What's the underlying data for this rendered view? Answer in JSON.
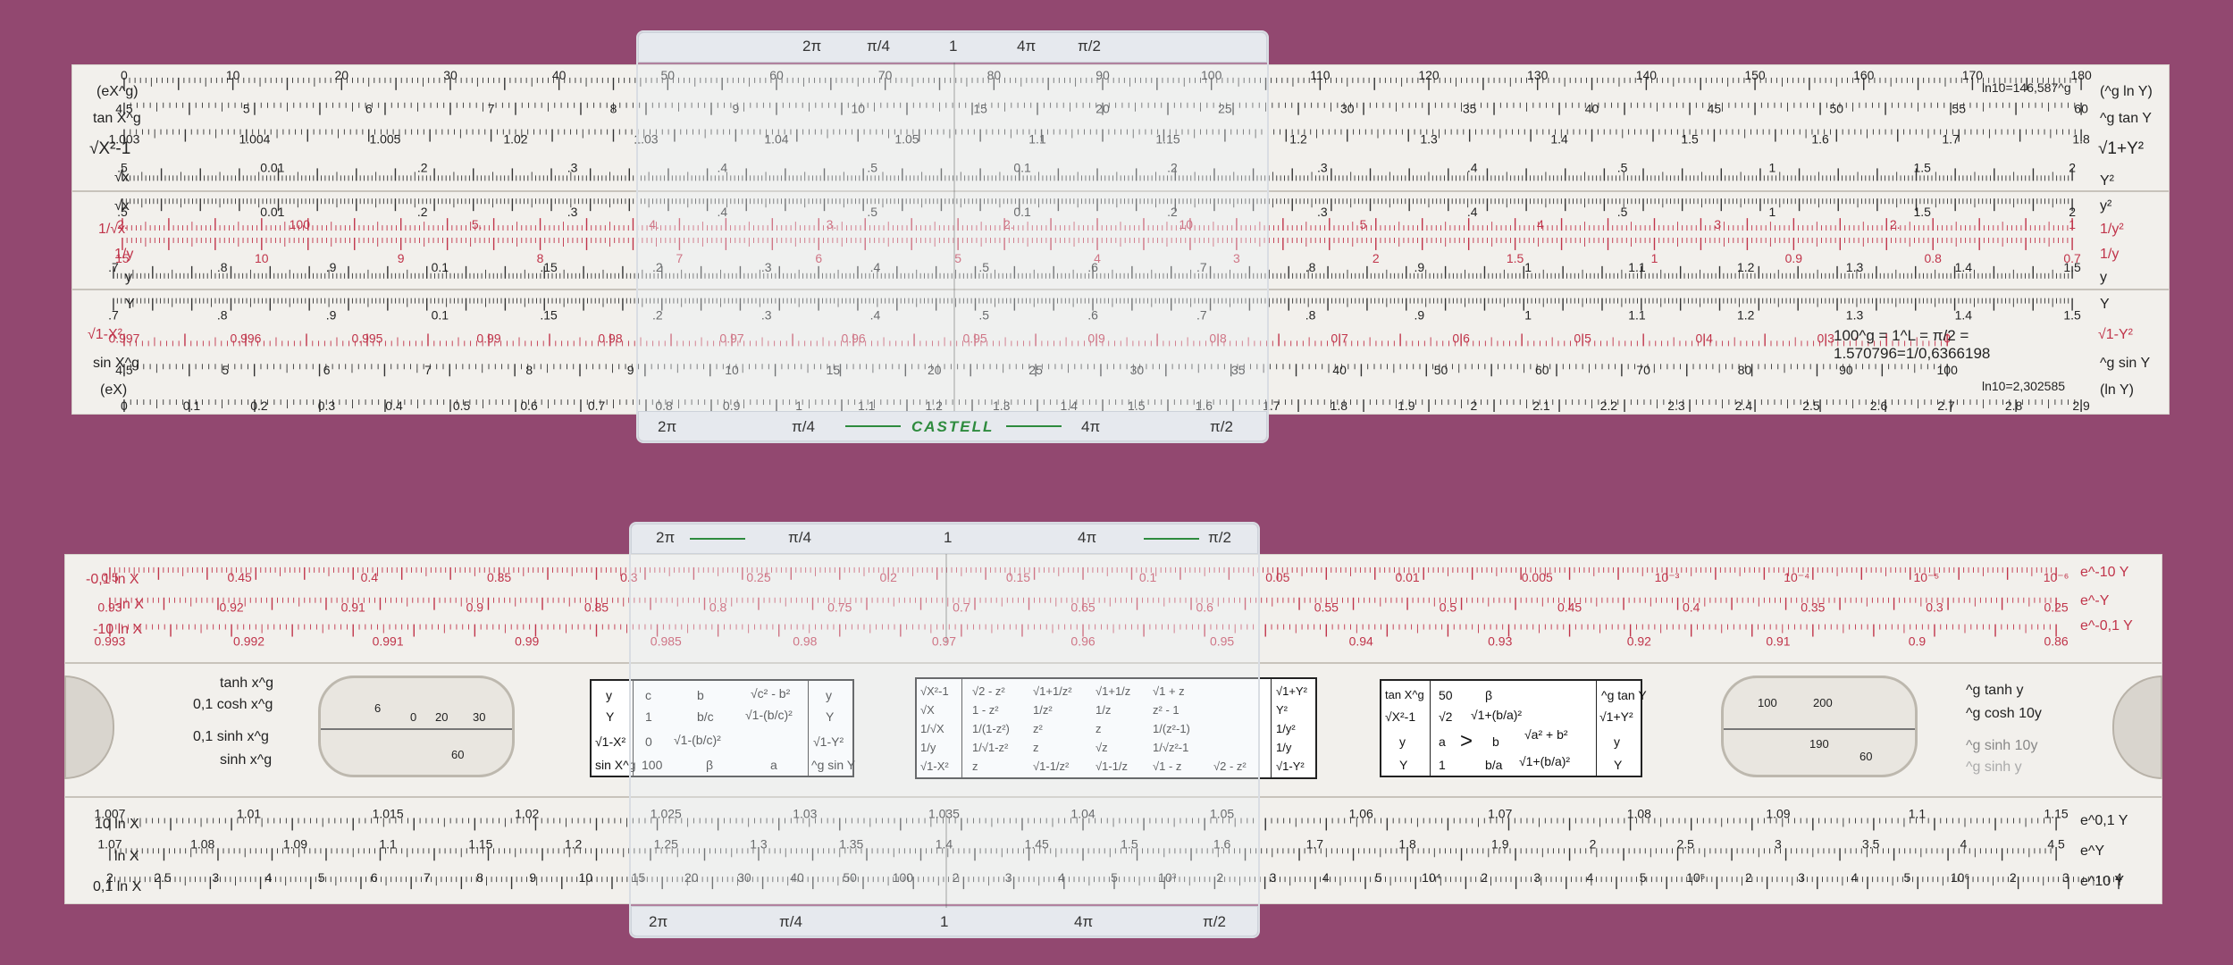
{
  "colors": {
    "background": "#924870",
    "rule": "#f2f0ec",
    "red": "#c0344a",
    "green": "#2e8b3e"
  },
  "top_rule": {
    "cursor": {
      "top": [
        "2π",
        "π/4",
        "1",
        "4π",
        "π/2"
      ],
      "bottom": [
        "2π",
        "π/4",
        "CASTELL",
        "4π",
        "π/2"
      ]
    },
    "left_labels": [
      "(eX^g)",
      "tan X^g",
      "√X²-1",
      "√x",
      "√x",
      "1/√x",
      "1/y",
      "y",
      "Y",
      "√1-X²",
      "sin X^g",
      "(eX)"
    ],
    "right_labels": [
      "(^g ln Y)",
      "^g tan Y",
      "√1+Y²",
      "Y²",
      "y²",
      "1/y²",
      "1/y",
      "y",
      "Y",
      "√1-Y²",
      "^g sin Y",
      "(ln Y)"
    ],
    "notes": [
      "ln10=146,587^g",
      "100^g = 1^L = π/2 =",
      "1.570796=1/0,6366198",
      "ln10=2,302585"
    ],
    "row1": [
      "0",
      "10",
      "20",
      "30",
      "40",
      "50",
      "60",
      "70",
      "80",
      "90",
      "100",
      "110",
      "120",
      "130",
      "140",
      "150",
      "160",
      "170",
      "180"
    ],
    "row2": [
      "4.5",
      "5",
      "6",
      "7",
      "8",
      "9",
      "10",
      "15",
      "20",
      "25",
      "30",
      "35",
      "40",
      "45",
      "50",
      "55",
      "60"
    ],
    "row3": [
      "1.003",
      "1.004",
      "1.005",
      "1.02",
      "1.03",
      "1.04",
      "1.05",
      "1.1",
      "1.15",
      "1.2",
      "1.3",
      "1.4",
      "1.5",
      "1.6",
      "1.7",
      "1.8"
    ],
    "row4": [
      ".5",
      "0.01",
      ".2",
      ".3",
      ".4",
      ".5",
      "0.1",
      ".2",
      ".3",
      ".4",
      ".5",
      "1",
      "1.5",
      "2"
    ],
    "row5": [
      ".5",
      "0.01",
      ".2",
      ".3",
      ".4",
      ".5",
      "0.1",
      ".2",
      ".3",
      ".4",
      ".5",
      "1",
      "1.5",
      "2"
    ],
    "row6": [
      "2.",
      "100",
      "5.",
      "4.",
      "3.",
      "2.",
      "10",
      "5",
      "4",
      "3",
      "2.",
      "1"
    ],
    "row7": [
      "15",
      "10",
      "9",
      "8",
      "7",
      "6",
      "5",
      "4",
      "3",
      "2",
      "1.5",
      "1",
      "0.9",
      "0.8",
      "0.7"
    ],
    "row8": [
      ".7",
      ".8",
      ".9",
      "0.1",
      ".15",
      ".2",
      ".3",
      ".4",
      ".5",
      ".6",
      ".7",
      ".8",
      ".9",
      "1",
      "1.1",
      "1.2",
      "1.3",
      "1.4",
      "1.5"
    ],
    "row9": [
      ".7",
      ".8",
      ".9",
      "0.1",
      ".15",
      ".2",
      ".3",
      ".4",
      ".5",
      ".6",
      ".7",
      ".8",
      ".9",
      "1",
      "1.1",
      "1.2",
      "1.3",
      "1.4",
      "1.5"
    ],
    "row10": [
      "0.997",
      "0.996",
      "0.995",
      "0.99",
      "0.98",
      "0.97",
      "0.96",
      "0.95",
      "0.9",
      "0.8",
      "0.7",
      "0.6",
      "0.5",
      "0.4",
      "0.3",
      "0"
    ],
    "row11": [
      "4.5",
      "5",
      "6",
      "7",
      "8",
      "9",
      "10",
      "15",
      "20",
      "25",
      "30",
      "35",
      "40",
      "50",
      "60",
      "70",
      "80",
      "90",
      "100"
    ],
    "row12": [
      "0",
      "0.1",
      "0.2",
      "0.3",
      "0.4",
      "0.5",
      "0.6",
      "0.7",
      "0.8",
      "0.9",
      "1",
      "1.1",
      "1.2",
      "1.3",
      "1.4",
      "1.5",
      "1.6",
      "1.7",
      "1.8",
      "1.9",
      "2",
      "2.1",
      "2.2",
      "2.3",
      "2.4",
      "2.5",
      "2.6",
      "2.7",
      "2.8",
      "2.9"
    ]
  },
  "bottom_rule": {
    "cursor": {
      "top": [
        "2π",
        "π/4",
        "1",
        "4π",
        "π/2"
      ],
      "bottom": [
        "2π",
        "π/4",
        "1",
        "4π",
        "π/2"
      ]
    },
    "left_top": [
      "-0,1 ln X",
      "-ln X",
      "-10 ln X"
    ],
    "right_top": [
      "e^-10 Y",
      "e^-Y",
      "e^-0,1 Y"
    ],
    "left_mid": [
      "tanh x^g",
      "0,1 cosh x^g",
      "0,1 sinh x^g",
      "sinh x^g"
    ],
    "right_mid": [
      "^g tanh y",
      "^g cosh 10y",
      "^g sinh 10y",
      "^g sinh y"
    ],
    "left_bot": [
      "10 ln X",
      "ln X",
      "0,1 ln X"
    ],
    "right_bot": [
      "e^0,1 Y",
      "e^Y",
      "e^10 Y"
    ],
    "r1": [
      "0.5",
      "0.45",
      "0.4",
      "0.35",
      "0.3",
      "0.25",
      "0.2",
      "0.15",
      "0.1",
      "0.05",
      "0.01",
      "0.005",
      "10⁻³",
      "10⁻⁴",
      "10⁻⁵",
      "10⁻⁶"
    ],
    "r2": [
      "0.93",
      "0.92",
      "0.91",
      "0.9",
      "0.85",
      "0.8",
      "0.75",
      "0.7",
      "0.65",
      "0.6",
      "0.55",
      "0.5",
      "0.45",
      "0.4",
      "0.35",
      "0.3",
      "0.25"
    ],
    "r3": [
      "0.993",
      "0.992",
      "0.991",
      "0.99",
      "0.985",
      "0.98",
      "0.97",
      "0.96",
      "0.95",
      "0.94",
      "0.93",
      "0.92",
      "0.91",
      "0.9",
      "0.86"
    ],
    "b1": [
      "1.007",
      "1.01",
      "1.015",
      "1.02",
      "1.025",
      "1.03",
      "1.035",
      "1.04",
      "1.05",
      "1.06",
      "1.07",
      "1.08",
      "1.09",
      "1.1",
      "1.15"
    ],
    "b2": [
      "1.07",
      "1.08",
      "1.09",
      "1.1",
      "1.15",
      "1.2",
      "1.25",
      "1.3",
      "1.35",
      "1.4",
      "1.45",
      "1.5",
      "1.6",
      "1.7",
      "1.8",
      "1.9",
      "2",
      "2.5",
      "3",
      "3.5",
      "4",
      "4.5"
    ],
    "b3": [
      "2",
      "2.5",
      "3",
      "4",
      "5",
      "6",
      "7",
      "8",
      "9",
      "10",
      "15",
      "20",
      "30",
      "40",
      "50",
      "100",
      "2",
      "3",
      "4",
      "5",
      "10³",
      "2",
      "3",
      "4",
      "5",
      "10⁴",
      "2",
      "3",
      "4",
      "5",
      "10⁵",
      "2",
      "3",
      "4",
      "5",
      "10⁶",
      "2",
      "3",
      "4"
    ],
    "table1": [
      [
        "y",
        "c",
        "b",
        "√c² - b²",
        "y"
      ],
      [
        "Y",
        "1",
        "b/c",
        "√1-(b/c)²",
        "Y"
      ],
      [
        "√1-X²",
        "0",
        "√1-(b/c)²",
        "",
        "√1-Y²"
      ],
      [
        "sin X^g",
        "100",
        "β",
        "a",
        "^g sin Y"
      ]
    ],
    "table2": [
      [
        "√X²-1",
        "√2 - z²",
        "√1+1/z²",
        "√1+1/z",
        "√1 + z",
        "√1+Y²"
      ],
      [
        "√X",
        "1 - z²",
        "1/z²",
        "1/z",
        "z² - 1",
        "Y²"
      ],
      [
        "1/√X",
        "1/(1-z²)",
        "z²",
        "z",
        "1/(z²-1)",
        "1/y²"
      ],
      [
        "1/y",
        "1/√1-z²",
        "z",
        "√z",
        "1/√z²-1",
        "1/y"
      ],
      [
        "√1-X²",
        "z",
        "√1-1/z²",
        "√1-1/z",
        "√1 - z",
        "√2 - z²",
        "√1-Y²"
      ]
    ],
    "table3": [
      [
        "tan X^g",
        "50",
        "β",
        "",
        "^g tan Y"
      ],
      [
        "√X²-1",
        "√2",
        "√1+(b/a)²",
        "",
        "√1+Y²"
      ],
      [
        "y",
        "a",
        ">",
        "b",
        "√a² + b²",
        "y"
      ],
      [
        "Y",
        "1",
        "b/a",
        "√1+(b/a)²",
        "Y"
      ]
    ],
    "win1": [
      "6",
      "0",
      "20",
      "30",
      "60"
    ],
    "win2": [
      "100",
      "200",
      "190",
      "60"
    ]
  }
}
